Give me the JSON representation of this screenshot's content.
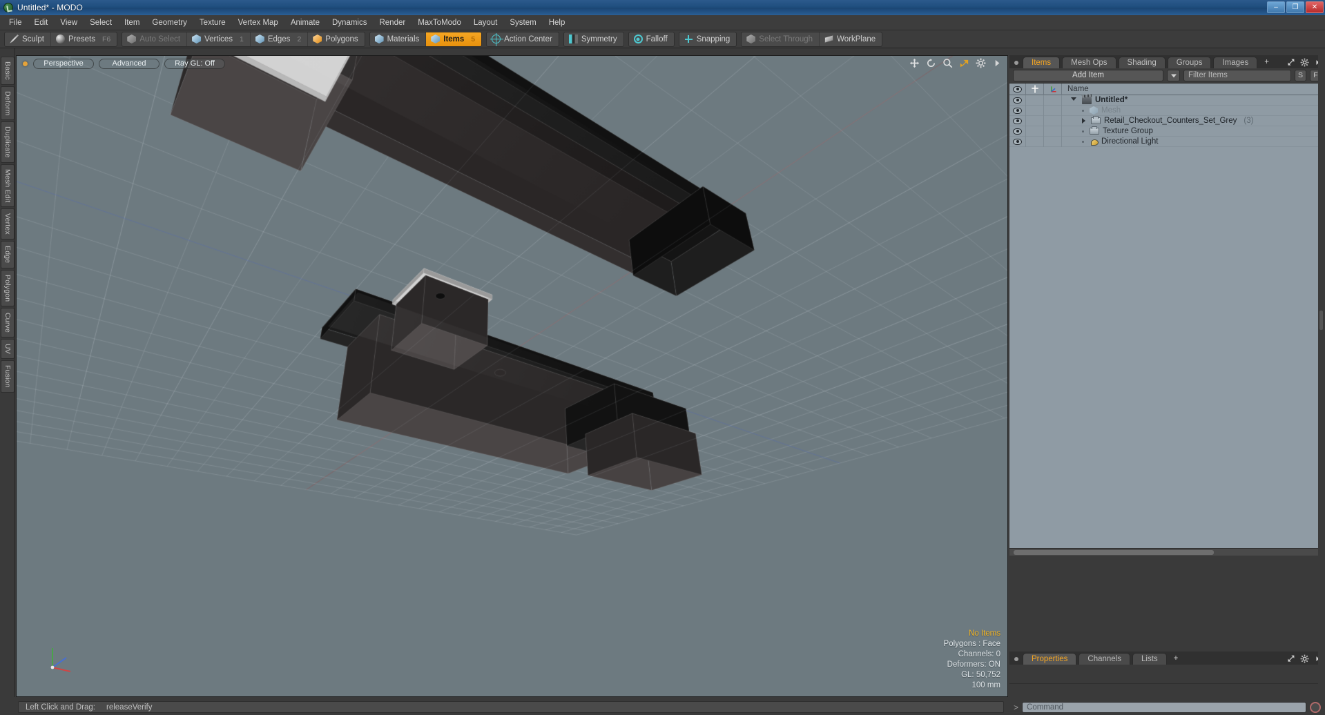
{
  "window": {
    "title": "Untitled* - MODO",
    "app_icon": "modo-logo-icon",
    "controls": {
      "minimize": "–",
      "maximize": "❐",
      "close": "✕"
    }
  },
  "menubar": {
    "items": [
      "File",
      "Edit",
      "View",
      "Select",
      "Item",
      "Geometry",
      "Texture",
      "Vertex Map",
      "Animate",
      "Dynamics",
      "Render",
      "MaxToModo",
      "Layout",
      "System",
      "Help"
    ]
  },
  "toolbar": {
    "groups": [
      {
        "name": "sculpt-presets",
        "buttons": [
          {
            "label": "Sculpt",
            "icon": "pencil-icon",
            "shortcut": "",
            "state": "normal"
          },
          {
            "label": "Presets",
            "icon": "sphere-icon",
            "shortcut": "F6",
            "state": "normal"
          }
        ]
      },
      {
        "name": "selection-modes",
        "buttons": [
          {
            "label": "Auto Select",
            "icon": "cube-gray-icon",
            "shortcut": "",
            "state": "dim"
          },
          {
            "label": "Vertices",
            "icon": "cube-blue-icon",
            "shortcut": "1",
            "state": "normal"
          },
          {
            "label": "Edges",
            "icon": "cube-blue-icon",
            "shortcut": "2",
            "state": "normal"
          },
          {
            "label": "Polygons",
            "icon": "cube-orange-icon",
            "shortcut": "",
            "state": "normal"
          }
        ]
      },
      {
        "name": "materials-items",
        "buttons": [
          {
            "label": "Materials",
            "icon": "cube-blue-icon",
            "shortcut": "",
            "state": "normal"
          },
          {
            "label": "Items",
            "icon": "cube-blue-icon",
            "shortcut": "5",
            "state": "active"
          }
        ]
      },
      {
        "name": "action-center",
        "buttons": [
          {
            "label": "Action Center",
            "icon": "target-icon",
            "shortcut": "",
            "state": "normal"
          }
        ]
      },
      {
        "name": "symmetry",
        "buttons": [
          {
            "label": "Symmetry",
            "icon": "symmetry-icon",
            "shortcut": "",
            "state": "normal"
          }
        ]
      },
      {
        "name": "falloff",
        "buttons": [
          {
            "label": "Falloff",
            "icon": "falloff-icon",
            "shortcut": "",
            "state": "normal"
          }
        ]
      },
      {
        "name": "snapping",
        "buttons": [
          {
            "label": "Snapping",
            "icon": "snap-icon",
            "shortcut": "",
            "state": "normal"
          }
        ]
      },
      {
        "name": "select-through-workplane",
        "buttons": [
          {
            "label": "Select Through",
            "icon": "cube-gray-icon",
            "shortcut": "",
            "state": "dim"
          },
          {
            "label": "WorkPlane",
            "icon": "plane-icon",
            "shortcut": "",
            "state": "normal"
          }
        ]
      }
    ]
  },
  "left_tabs": {
    "items": [
      "Basic",
      "Deform",
      "Duplicate",
      "Mesh Edit",
      "Vertex",
      "Edge",
      "Polygon",
      "Curve",
      "UV",
      "Fusion"
    ]
  },
  "viewport": {
    "indicator_color": "#e5a33a",
    "pills": [
      {
        "label": "Perspective",
        "name": "view-mode-selector"
      },
      {
        "label": "Advanced",
        "name": "shading-mode-selector"
      },
      {
        "label": "Ray GL: Off",
        "name": "raygl-toggle"
      }
    ],
    "tools": [
      {
        "name": "pan-tool-icon"
      },
      {
        "name": "rotate-tool-icon"
      },
      {
        "name": "zoom-tool-icon"
      },
      {
        "name": "fit-view-icon"
      },
      {
        "name": "gear-icon"
      },
      {
        "name": "chevron-right-icon"
      }
    ],
    "info": {
      "selection": "No Items",
      "polygons": "Polygons : Face",
      "channels": "Channels: 0",
      "deformers": "Deformers: ON",
      "gl": "GL: 50,752",
      "gridsize": "100 mm"
    },
    "gizmo_axes": [
      "X",
      "Y",
      "Z"
    ],
    "background_color": "#6d7a80",
    "model_description": "Retail checkout counters set in dark grey with light grey countertop panels"
  },
  "right_panel": {
    "tabs": [
      {
        "label": "Items",
        "active": true
      },
      {
        "label": "Mesh Ops",
        "active": false
      },
      {
        "label": "Shading",
        "active": false
      },
      {
        "label": "Groups",
        "active": false
      },
      {
        "label": "Images",
        "active": false
      },
      {
        "label": "+",
        "active": false
      }
    ],
    "toolrow": {
      "add_item_label": "Add Item",
      "filter_placeholder": "Filter Items",
      "filter_value": "",
      "btn_s": "S",
      "btn_f": "F"
    },
    "tree_headers": {
      "eye": "visibility-icon",
      "lock": "lock-icon",
      "axis": "axis-icon",
      "name": "Name"
    },
    "tree_rows": [
      {
        "label": "Untitled*",
        "count": "",
        "icon": "scene-icon",
        "indent": 0,
        "expander": "open",
        "bold": true,
        "dim": false
      },
      {
        "label": "Mesh",
        "count": "",
        "icon": "mesh-icon",
        "indent": 1,
        "expander": "dot",
        "bold": false,
        "dim": true
      },
      {
        "label": "Retail_Checkout_Counters_Set_Grey",
        "count": "(3)",
        "icon": "folder-icon",
        "indent": 1,
        "expander": "closed",
        "bold": false,
        "dim": false
      },
      {
        "label": "Texture Group",
        "count": "",
        "icon": "folder-icon",
        "indent": 1,
        "expander": "dot",
        "bold": false,
        "dim": false
      },
      {
        "label": "Directional Light",
        "count": "",
        "icon": "light-icon",
        "indent": 1,
        "expander": "dot",
        "bold": false,
        "dim": false
      }
    ]
  },
  "properties_panel": {
    "tabs": [
      {
        "label": "Properties",
        "active": true
      },
      {
        "label": "Channels",
        "active": false
      },
      {
        "label": "Lists",
        "active": false
      },
      {
        "label": "+",
        "active": false
      }
    ]
  },
  "command_bar": {
    "prompt": ">",
    "placeholder": "Command",
    "value": "",
    "record_button": "record-icon"
  },
  "statusbar": {
    "hint_label": "Left Click and Drag:",
    "hint_value": "releaseVerify"
  }
}
